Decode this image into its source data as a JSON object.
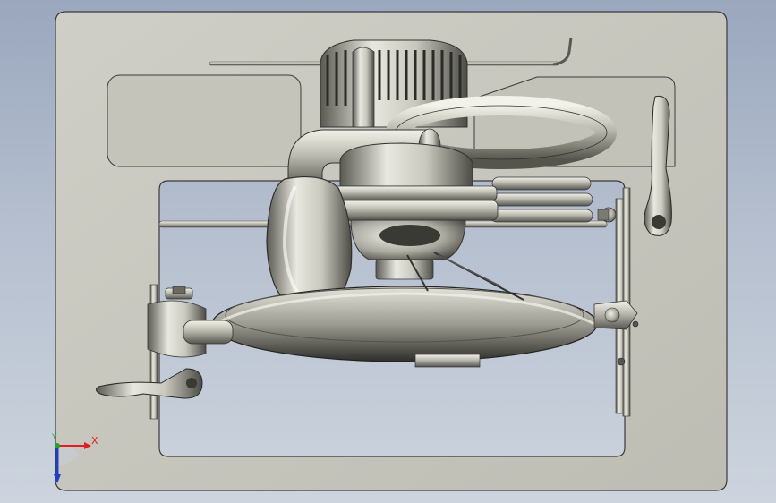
{
  "viewport": {
    "background_top": "#9aa7bd",
    "background_bottom": "#cdd4de"
  },
  "triad": {
    "x_label": "X",
    "y_label": "Y",
    "x_color": "#e02020",
    "y_color": "#2aa02a",
    "z_color": "#2040c0"
  },
  "colors": {
    "plate": "#c8c8c0",
    "plate_edge": "#3a3a3a",
    "metal_light": "#e6e6de",
    "metal_mid": "#a9a99f",
    "metal_dark": "#4a4a44"
  }
}
